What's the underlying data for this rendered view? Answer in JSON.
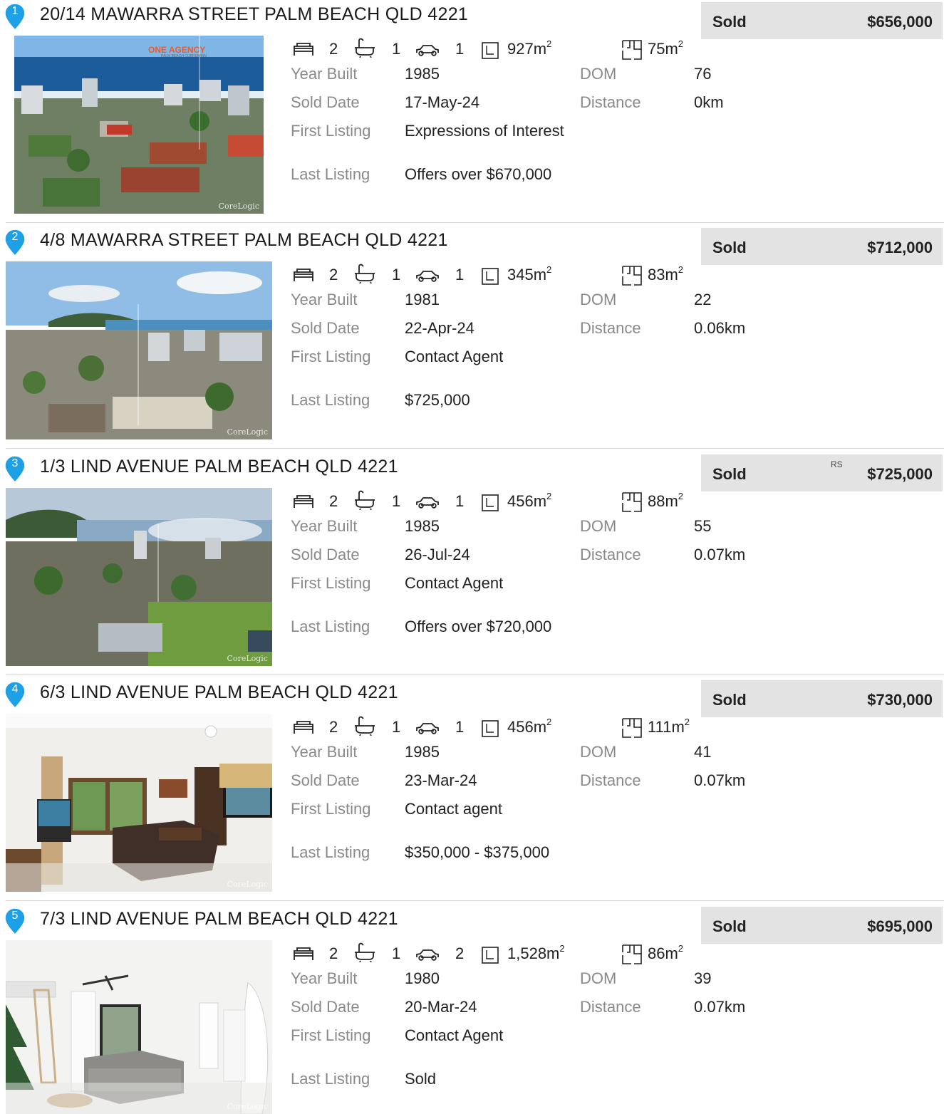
{
  "listings": [
    {
      "number": "1",
      "address": "20/14 MAWARRA STREET PALM BEACH QLD 4221",
      "status": "Sold",
      "price": "$656,000",
      "price_note": "",
      "beds": "2",
      "baths": "1",
      "cars": "1",
      "land": "927m",
      "floor": "75m",
      "labels": {
        "year_built": "Year Built",
        "sold_date": "Sold Date",
        "first_listing": "First Listing",
        "last_listing": "Last Listing",
        "dom": "DOM",
        "distance": "Distance"
      },
      "year_built": "1985",
      "sold_date": "17-May-24",
      "first_listing": "Expressions of Interest",
      "last_listing": "Offers over $670,000",
      "dom": "76",
      "distance": "0km",
      "photo_brand": "ONE AGENCY",
      "photo_brand_sub": "PALM BEACH CURRUMBIN",
      "watermark": "CoreLogic"
    },
    {
      "number": "2",
      "address": "4/8 MAWARRA STREET PALM BEACH QLD 4221",
      "status": "Sold",
      "price": "$712,000",
      "price_note": "",
      "beds": "2",
      "baths": "1",
      "cars": "1",
      "land": "345m",
      "floor": "83m",
      "labels": {
        "year_built": "Year Built",
        "sold_date": "Sold Date",
        "first_listing": "First Listing",
        "last_listing": "Last Listing",
        "dom": "DOM",
        "distance": "Distance"
      },
      "year_built": "1981",
      "sold_date": "22-Apr-24",
      "first_listing": "Contact Agent",
      "last_listing": "$725,000",
      "dom": "22",
      "distance": "0.06km",
      "photo_brand": "",
      "photo_brand_sub": "",
      "watermark": "CoreLogic"
    },
    {
      "number": "3",
      "address": "1/3 LIND AVENUE PALM BEACH QLD 4221",
      "status": "Sold",
      "price": "$725,000",
      "price_note": "RS",
      "beds": "2",
      "baths": "1",
      "cars": "1",
      "land": "456m",
      "floor": "88m",
      "labels": {
        "year_built": "Year Built",
        "sold_date": "Sold Date",
        "first_listing": "First Listing",
        "last_listing": "Last Listing",
        "dom": "DOM",
        "distance": "Distance"
      },
      "year_built": "1985",
      "sold_date": "26-Jul-24",
      "first_listing": "Contact Agent",
      "last_listing": "Offers over $720,000",
      "dom": "55",
      "distance": "0.07km",
      "photo_brand": "",
      "photo_brand_sub": "",
      "watermark": "CoreLogic"
    },
    {
      "number": "4",
      "address": "6/3 LIND AVENUE PALM BEACH QLD 4221",
      "status": "Sold",
      "price": "$730,000",
      "price_note": "",
      "beds": "2",
      "baths": "1",
      "cars": "1",
      "land": "456m",
      "floor": "111m",
      "labels": {
        "year_built": "Year Built",
        "sold_date": "Sold Date",
        "first_listing": "First Listing",
        "last_listing": "Last Listing",
        "dom": "DOM",
        "distance": "Distance"
      },
      "year_built": "1985",
      "sold_date": "23-Mar-24",
      "first_listing": "Contact agent",
      "last_listing": "$350,000 - $375,000",
      "dom": "41",
      "distance": "0.07km",
      "photo_brand": "",
      "photo_brand_sub": "",
      "watermark": "CoreLogic"
    },
    {
      "number": "5",
      "address": "7/3 LIND AVENUE PALM BEACH QLD 4221",
      "status": "Sold",
      "price": "$695,000",
      "price_note": "",
      "beds": "2",
      "baths": "1",
      "cars": "2",
      "land": "1,528m",
      "floor": "86m",
      "labels": {
        "year_built": "Year Built",
        "sold_date": "Sold Date",
        "first_listing": "First Listing",
        "last_listing": "Last Listing",
        "dom": "DOM",
        "distance": "Distance"
      },
      "year_built": "1980",
      "sold_date": "20-Mar-24",
      "first_listing": "Contact Agent",
      "last_listing": "Sold",
      "dom": "39",
      "distance": "0.07km",
      "photo_brand": "",
      "photo_brand_sub": "",
      "watermark": "CoreLogic"
    }
  ],
  "area_unit_power": "2",
  "colors": {
    "pin": "#1ea0e6",
    "sold_box": "#e3e3e3",
    "label_grey": "#8a8a8a",
    "brand_orange": "#f05a28"
  }
}
